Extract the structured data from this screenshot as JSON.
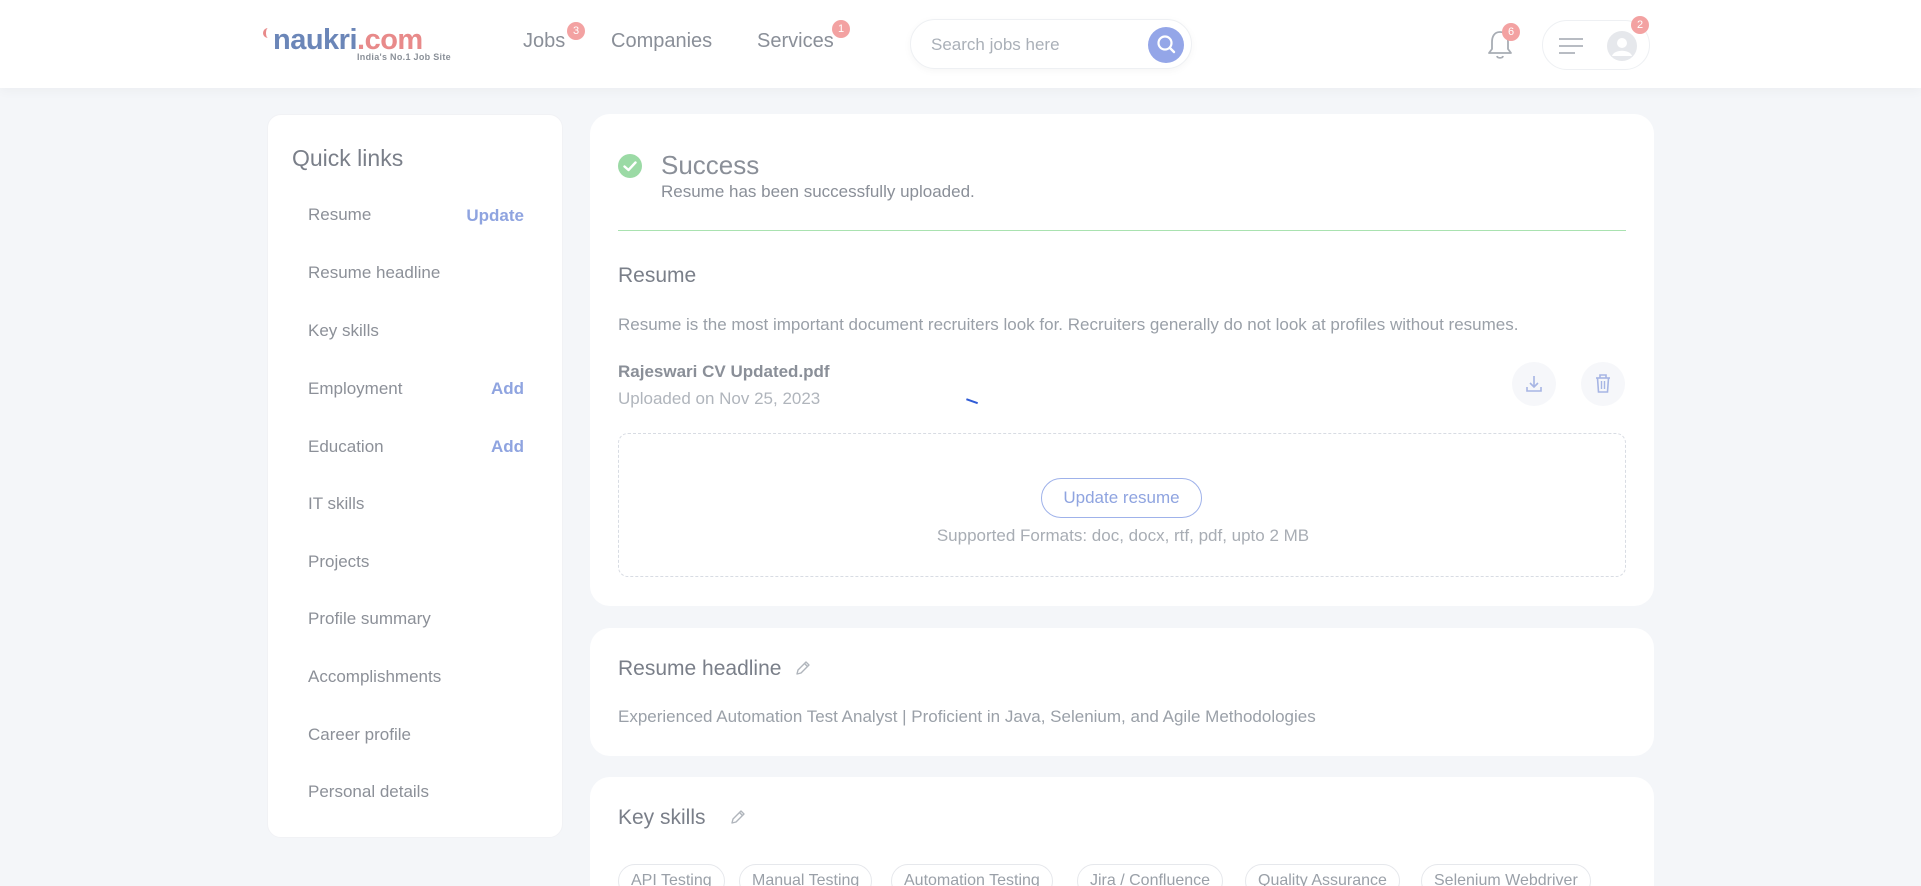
{
  "header": {
    "logo_text_main": "naukri",
    "logo_text_dot": ".com",
    "logo_tagline": "India's No.1 Job Site",
    "nav": [
      {
        "label": "Jobs",
        "badge": "3"
      },
      {
        "label": "Companies",
        "badge": ""
      },
      {
        "label": "Services",
        "badge": "1"
      }
    ],
    "search": {
      "placeholder": "Search jobs here"
    },
    "notifications_badge": "6",
    "menu_badge": "2"
  },
  "sidebar": {
    "title": "Quick links",
    "items": [
      {
        "label": "Resume",
        "action": "Update"
      },
      {
        "label": "Resume headline",
        "action": ""
      },
      {
        "label": "Key skills",
        "action": ""
      },
      {
        "label": "Employment",
        "action": "Add"
      },
      {
        "label": "Education",
        "action": "Add"
      },
      {
        "label": "IT skills",
        "action": ""
      },
      {
        "label": "Projects",
        "action": ""
      },
      {
        "label": "Profile summary",
        "action": ""
      },
      {
        "label": "Accomplishments",
        "action": ""
      },
      {
        "label": "Career profile",
        "action": ""
      },
      {
        "label": "Personal details",
        "action": ""
      }
    ]
  },
  "resume_card": {
    "success_title": "Success",
    "success_message": "Resume has been successfully uploaded.",
    "title": "Resume",
    "description": "Resume is the most important document recruiters look for. Recruiters generally do not look at profiles without resumes.",
    "file_name": "Rajeswari CV Updated.pdf",
    "uploaded_on": "Uploaded on Nov 25, 2023",
    "update_button": "Update resume",
    "formats": "Supported Formats: doc, docx, rtf, pdf, upto 2 MB"
  },
  "headline_card": {
    "title": "Resume headline",
    "text": "Experienced Automation Test Analyst | Proficient in Java, Selenium, and Agile Methodologies"
  },
  "skills_card": {
    "title": "Key skills",
    "skills": [
      "API Testing",
      "Manual Testing",
      "Automation Testing",
      "Jira / Confluence",
      "Quality Assurance",
      "Selenium Webdriver"
    ]
  },
  "colors": {
    "accent": "#8fa4e0",
    "success": "#9bdaa5",
    "badge": "#f3a2a2"
  }
}
